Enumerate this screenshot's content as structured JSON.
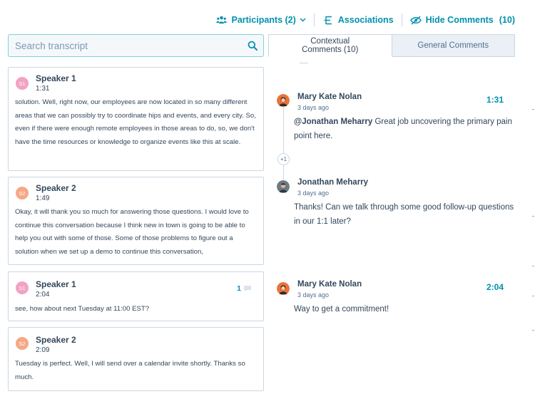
{
  "toolbar": {
    "participants_label": "Participants (2)",
    "associations_label": "Associations",
    "hide_comments_label": "Hide Comments",
    "hide_comments_count": "(10)"
  },
  "search": {
    "placeholder": "Search transcript",
    "value": ""
  },
  "tabs": [
    {
      "label": "Contextual Comments (10)",
      "active": true
    },
    {
      "label": "General Comments",
      "active": false
    }
  ],
  "transcript": [
    {
      "initials": "S1",
      "speaker": "Speaker 1",
      "time": "1:31",
      "text": "solution. Well, right now, our employees are now located in so many different areas that we can possibly try to coordinate hips and events, and every city. So, even if there were enough remote employees in those areas to do, so, we don't have the time resources or knowledge to organize events like this at scale."
    },
    {
      "initials": "S2",
      "speaker": "Speaker 2",
      "time": "1:49",
      "text": "Okay, it will thank you so much for answering those questions. I would love to continue this conversation because I think new in town is going to be able to help you out with some of those. Some of those problems to figure out a solution when we set up a demo to continue this conversation,"
    },
    {
      "initials": "S1",
      "speaker": "Speaker 1",
      "time": "2:04",
      "comment_count": "1",
      "text": "see, how about next Tuesday at 11:00 EST?"
    },
    {
      "initials": "S2",
      "speaker": "Speaker 2",
      "time": "2:09",
      "text": "Tuesday is perfect. Well, I will send over a calendar invite shortly. Thanks so much."
    }
  ],
  "comments": [
    {
      "author": "Mary Kate Nolan",
      "ago": "3 days ago",
      "timestamp": "1:31",
      "mention": "@Jonathan Meharry",
      "text": " Great job uncovering the primary pain point here."
    },
    {
      "more_replies": "+1"
    },
    {
      "author": "Jonathan Meharry",
      "ago": "3 days ago",
      "text": "Thanks! Can we talk through some good follow-up questions in our 1:1 later?"
    },
    {
      "author": "Mary Kate Nolan",
      "ago": "3 days ago",
      "timestamp": "2:04",
      "text": "Way to get a commitment!"
    }
  ],
  "colors": {
    "accent": "#0091ae",
    "text": "#33475b",
    "border": "#cbd6e2",
    "speaker1": "#f2a2c2",
    "speaker2": "#f5a886"
  },
  "icons": {
    "participants": "people-icon",
    "associations": "associations-icon",
    "hide_comments": "eye-slash-icon",
    "search": "search-icon",
    "comment": "comment-bubble-icon"
  }
}
